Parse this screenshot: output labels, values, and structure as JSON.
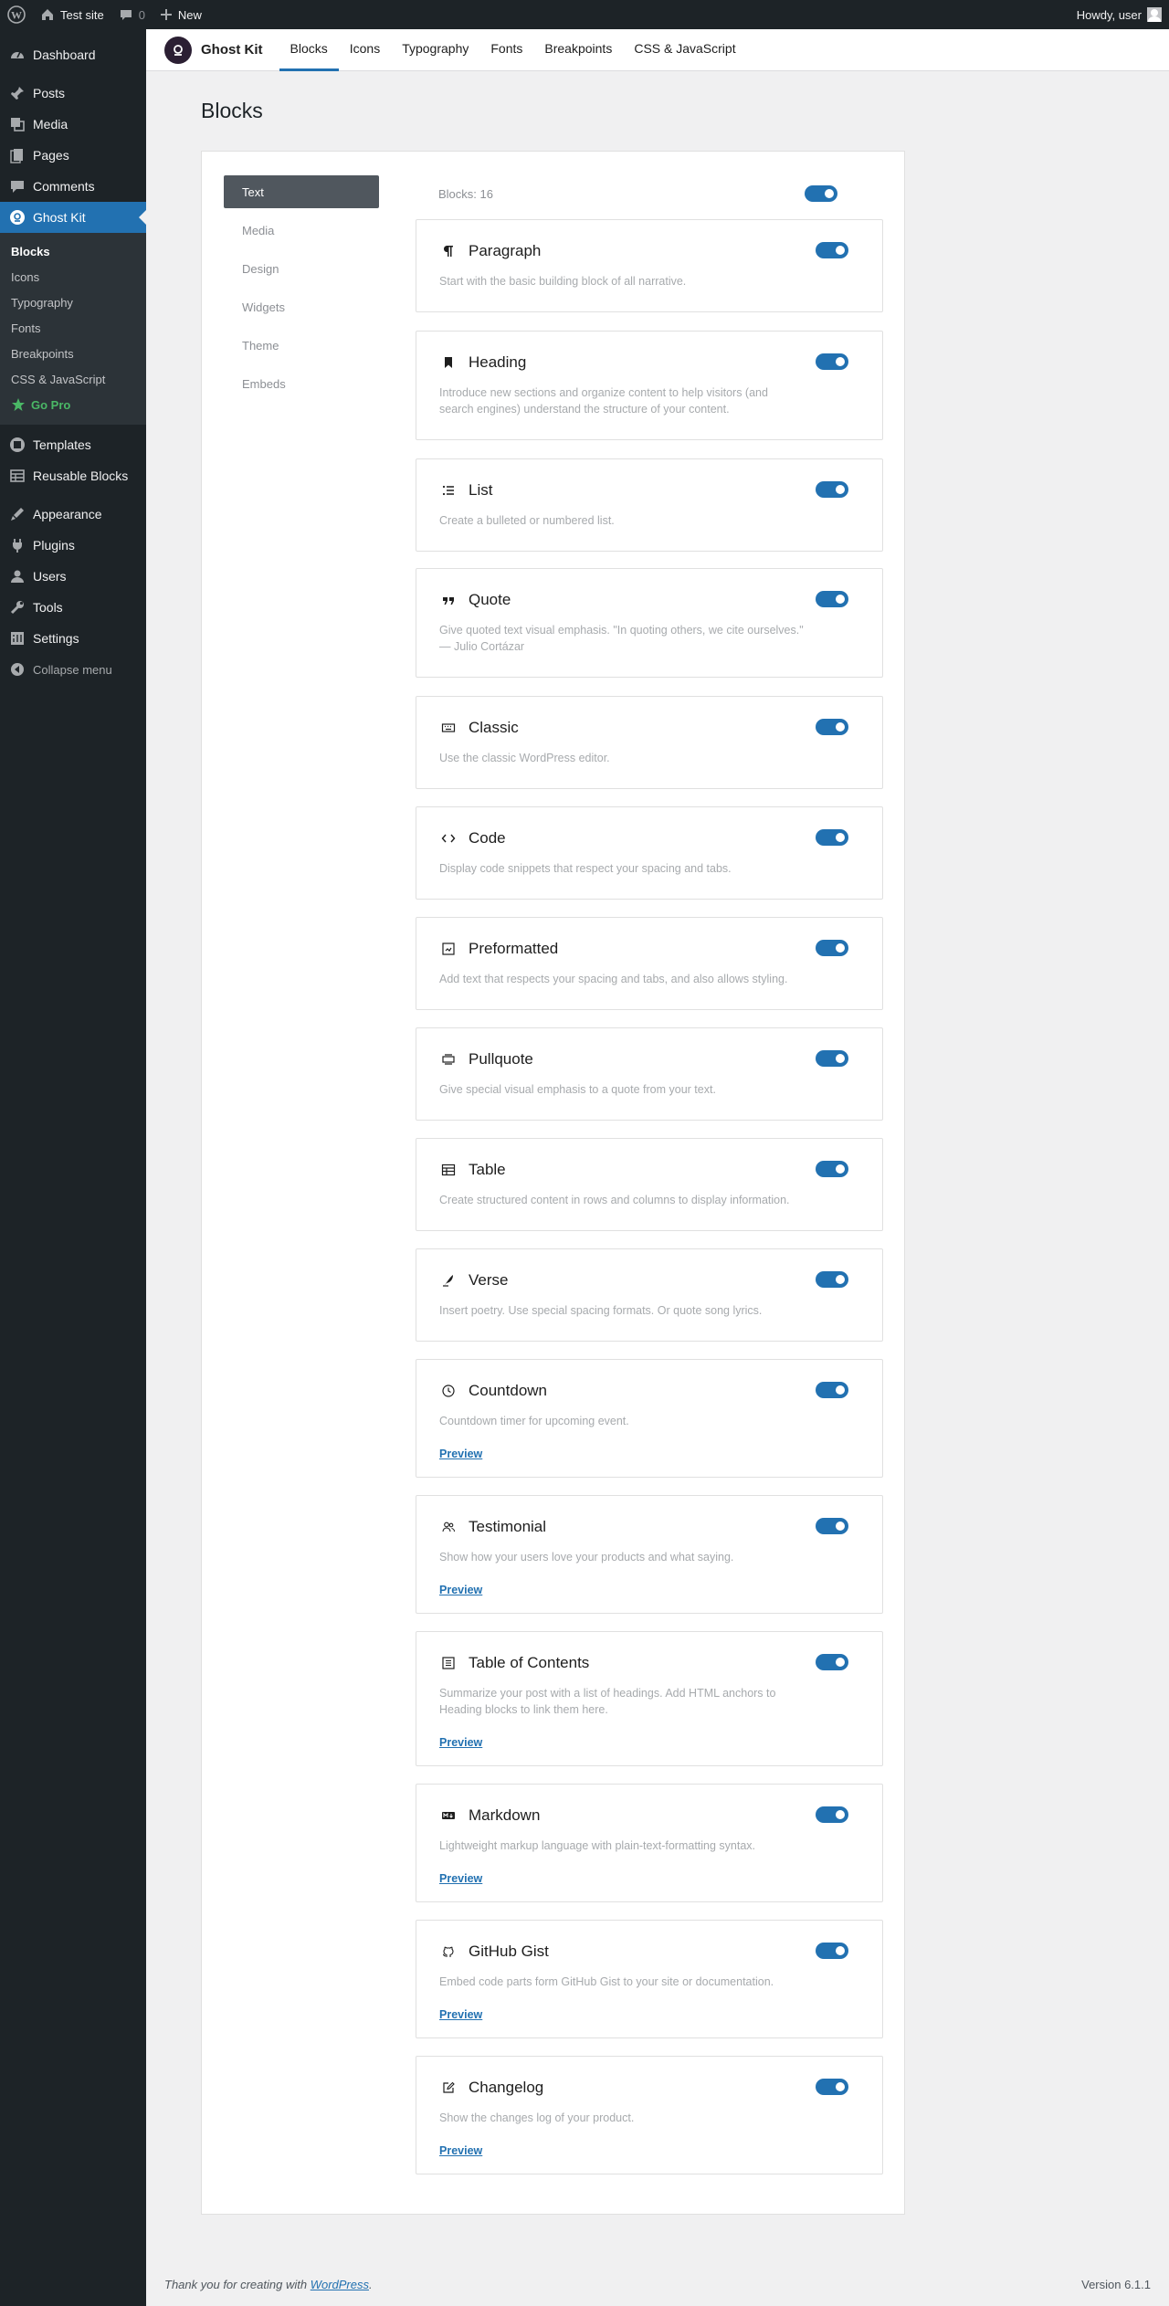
{
  "adminbar": {
    "site_name": "Test site",
    "comments_count": "0",
    "new_label": "New",
    "howdy": "Howdy, user"
  },
  "sidebar": {
    "items": [
      {
        "label": "Dashboard",
        "icon": "dashboard-icon"
      },
      {
        "label": "Posts",
        "icon": "pin-icon"
      },
      {
        "label": "Media",
        "icon": "media-icon"
      },
      {
        "label": "Pages",
        "icon": "pages-icon"
      },
      {
        "label": "Comments",
        "icon": "comment-icon"
      },
      {
        "label": "Ghost Kit",
        "icon": "ghostkit-icon"
      }
    ],
    "submenu": [
      "Blocks",
      "Icons",
      "Typography",
      "Fonts",
      "Breakpoints",
      "CSS & JavaScript",
      "Go Pro"
    ],
    "items2": [
      {
        "label": "Templates",
        "icon": "templates-icon"
      },
      {
        "label": "Reusable Blocks",
        "icon": "reusable-icon"
      }
    ],
    "items3": [
      {
        "label": "Appearance",
        "icon": "appearance-icon"
      },
      {
        "label": "Plugins",
        "icon": "plugins-icon"
      },
      {
        "label": "Users",
        "icon": "users-icon"
      },
      {
        "label": "Tools",
        "icon": "tools-icon"
      },
      {
        "label": "Settings",
        "icon": "settings-icon"
      }
    ],
    "collapse": "Collapse menu"
  },
  "header": {
    "brand": "Ghost Kit",
    "tabs": [
      "Blocks",
      "Icons",
      "Typography",
      "Fonts",
      "Breakpoints",
      "CSS & JavaScript"
    ]
  },
  "page": {
    "title": "Blocks",
    "block_count": "Blocks: 16"
  },
  "categories": [
    "Text",
    "Media",
    "Design",
    "Widgets",
    "Theme",
    "Embeds"
  ],
  "blocks": [
    {
      "title": "Paragraph",
      "desc": "Start with the basic building block of all narrative.",
      "icon": "paragraph-icon",
      "enabled": true
    },
    {
      "title": "Heading",
      "desc": "Introduce new sections and organize content to help visitors (and search engines) understand the structure of your content.",
      "icon": "heading-icon",
      "enabled": true
    },
    {
      "title": "List",
      "desc": "Create a bulleted or numbered list.",
      "icon": "list-icon",
      "enabled": true
    },
    {
      "title": "Quote",
      "desc": "Give quoted text visual emphasis. \"In quoting others, we cite ourselves.\" — Julio Cortázar",
      "icon": "quote-icon",
      "enabled": true
    },
    {
      "title": "Classic",
      "desc": "Use the classic WordPress editor.",
      "icon": "classic-icon",
      "enabled": true
    },
    {
      "title": "Code",
      "desc": "Display code snippets that respect your spacing and tabs.",
      "icon": "code-icon",
      "enabled": true
    },
    {
      "title": "Preformatted",
      "desc": "Add text that respects your spacing and tabs, and also allows styling.",
      "icon": "preformatted-icon",
      "enabled": true
    },
    {
      "title": "Pullquote",
      "desc": "Give special visual emphasis to a quote from your text.",
      "icon": "pullquote-icon",
      "enabled": true
    },
    {
      "title": "Table",
      "desc": "Create structured content in rows and columns to display information.",
      "icon": "table-icon",
      "enabled": true
    },
    {
      "title": "Verse",
      "desc": "Insert poetry. Use special spacing formats. Or quote song lyrics.",
      "icon": "verse-icon",
      "enabled": true
    },
    {
      "title": "Countdown",
      "desc": "Countdown timer for upcoming event.",
      "icon": "clock-icon",
      "enabled": true,
      "preview": "Preview"
    },
    {
      "title": "Testimonial",
      "desc": "Show how your users love your products and what saying.",
      "icon": "testimonial-icon",
      "enabled": true,
      "preview": "Preview"
    },
    {
      "title": "Table of Contents",
      "desc": "Summarize your post with a list of headings. Add HTML anchors to Heading blocks to link them here.",
      "icon": "toc-icon",
      "enabled": true,
      "preview": "Preview"
    },
    {
      "title": "Markdown",
      "desc": "Lightweight markup language with plain-text-formatting syntax.",
      "icon": "markdown-icon",
      "enabled": true,
      "preview": "Preview"
    },
    {
      "title": "GitHub Gist",
      "desc": "Embed code parts form GitHub Gist to your site or documentation.",
      "icon": "github-icon",
      "enabled": true,
      "preview": "Preview"
    },
    {
      "title": "Changelog",
      "desc": "Show the changes log of your product.",
      "icon": "changelog-icon",
      "enabled": true,
      "preview": "Preview"
    }
  ],
  "footer": {
    "thanks_prefix": "Thank you for creating with ",
    "thanks_link": "WordPress",
    "thanks_suffix": ".",
    "version": "Version 6.1.1"
  },
  "colors": {
    "accent": "#2271b1",
    "adminbar": "#1d2327",
    "gopro": "#4ab866"
  }
}
